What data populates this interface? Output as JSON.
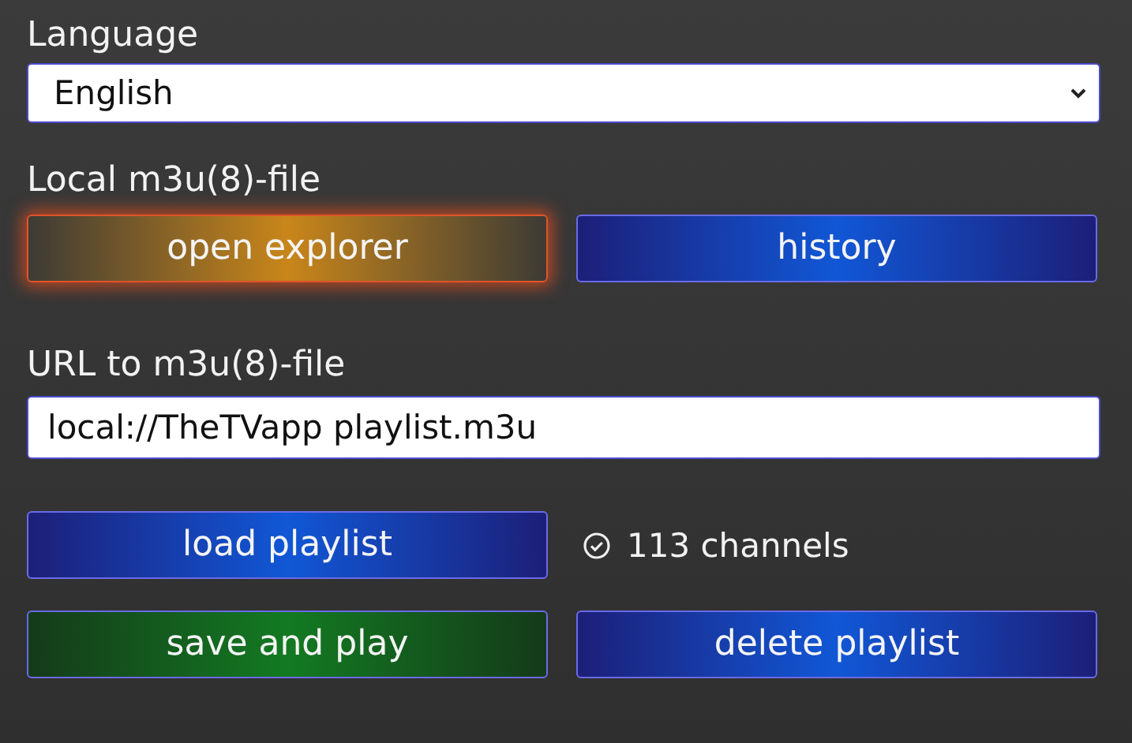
{
  "language": {
    "label": "Language",
    "value": "English"
  },
  "local": {
    "label": "Local m3u(8)-file",
    "buttons": [
      {
        "label": "open explorer",
        "kind": "orange",
        "focused": true
      },
      {
        "label": "history",
        "kind": "blue",
        "focused": false
      }
    ]
  },
  "url": {
    "label": "URL to m3u(8)-file",
    "value": "local://TheTVapp playlist.m3u"
  },
  "load": {
    "button": {
      "label": "load playlist",
      "kind": "blue",
      "focused": false
    },
    "status": "113 channels",
    "ok": true
  },
  "actions": [
    {
      "label": "save and play",
      "kind": "green",
      "focused": false
    },
    {
      "label": "delete playlist",
      "kind": "blue",
      "focused": false
    }
  ]
}
